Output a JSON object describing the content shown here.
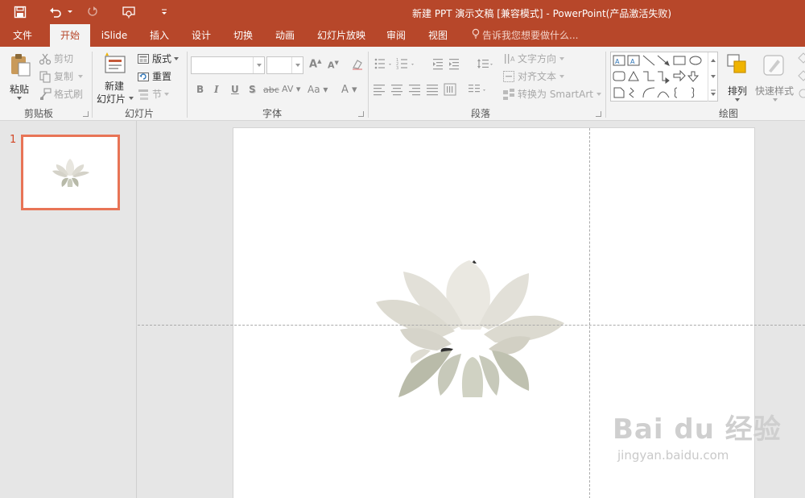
{
  "window": {
    "title": "新建 PPT 演示文稿 [兼容模式] - PowerPoint(产品激活失败)"
  },
  "tabs": [
    {
      "label": "文件"
    },
    {
      "label": "开始"
    },
    {
      "label": "iSlide"
    },
    {
      "label": "插入"
    },
    {
      "label": "设计"
    },
    {
      "label": "切换"
    },
    {
      "label": "动画"
    },
    {
      "label": "幻灯片放映"
    },
    {
      "label": "审阅"
    },
    {
      "label": "视图"
    }
  ],
  "active_tab": "开始",
  "tell_me": "告诉我您想要做什么...",
  "clipboard": {
    "paste": "粘贴",
    "cut": "剪切",
    "copy": "复制",
    "format_painter": "格式刷",
    "group_label": "剪贴板"
  },
  "slides_group": {
    "new_slide_line1": "新建",
    "new_slide_line2": "幻灯片",
    "layout": "版式",
    "reset": "重置",
    "section": "节",
    "group_label": "幻灯片"
  },
  "font_group": {
    "font_name": "",
    "font_size": "",
    "bold": "B",
    "italic": "I",
    "underline": "U",
    "shadow": "S",
    "strike": "abc",
    "spacing": "AV",
    "case": "Aa",
    "color": "A",
    "grow": "A",
    "shrink": "A",
    "group_label": "字体"
  },
  "paragraph_group": {
    "text_direction": "文字方向",
    "align_text": "对齐文本",
    "smartart": "转换为 SmartArt",
    "group_label": "段落"
  },
  "drawing_group": {
    "arrange": "排列",
    "quick_styles": "快速样式",
    "group_label": "绘图"
  },
  "thumbnails": [
    {
      "number": "1",
      "selected": true
    }
  ],
  "watermark": {
    "logo": "Bai du 经验",
    "url": "jingyan.baidu.com"
  },
  "colors": {
    "accent": "#b7472a",
    "thumb_border": "#e87456",
    "ribbon": "#f3f3f3",
    "workspace": "#e6e6e6"
  }
}
